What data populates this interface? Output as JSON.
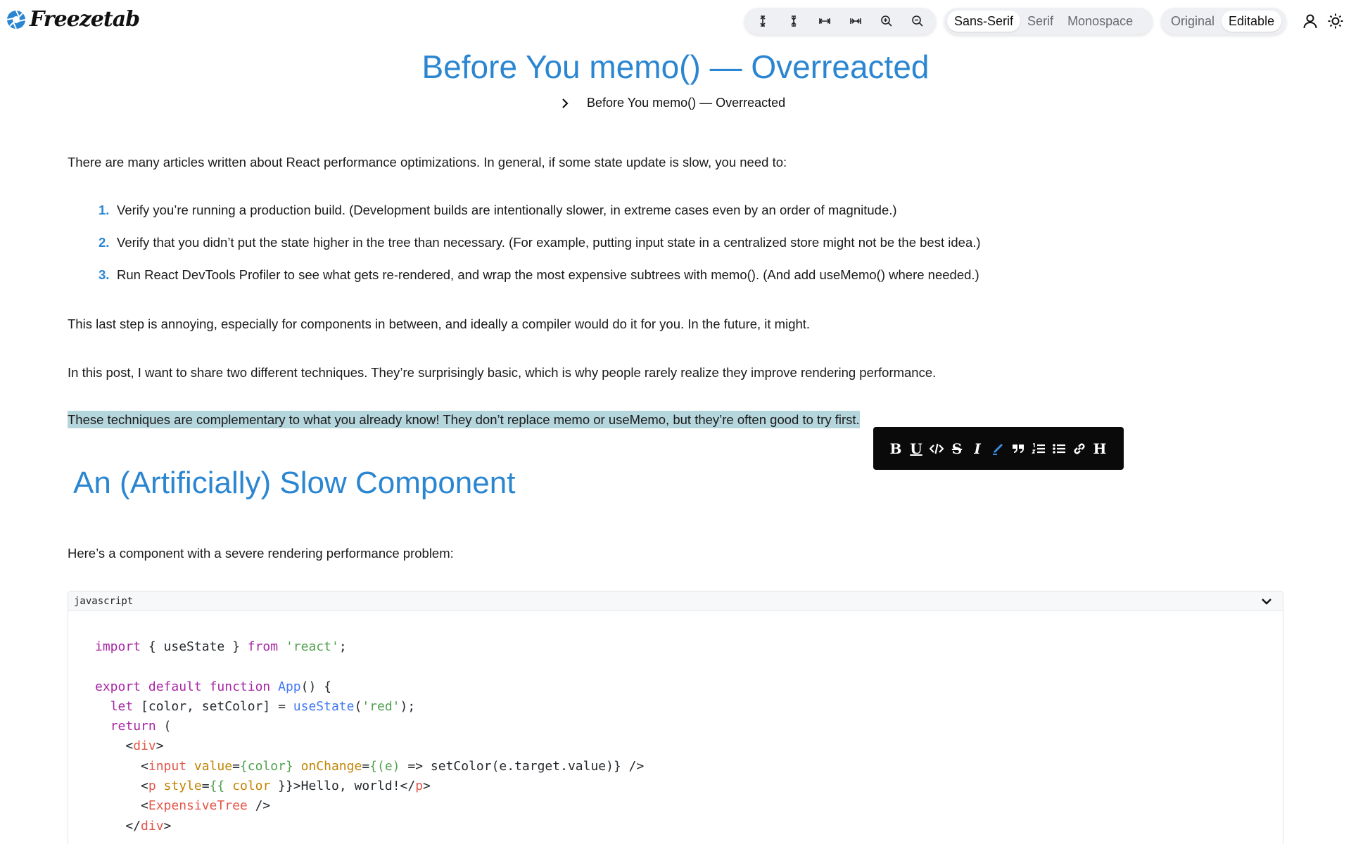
{
  "app": {
    "name": "Freezetab"
  },
  "toolbar": {
    "tools": [
      {
        "name": "increase-line-height-icon"
      },
      {
        "name": "decrease-line-height-icon"
      },
      {
        "name": "increase-width-icon"
      },
      {
        "name": "decrease-width-icon"
      },
      {
        "name": "zoom-in-icon"
      },
      {
        "name": "zoom-out-icon"
      }
    ],
    "fonts": [
      "Sans-Serif",
      "Serif",
      "Monospace"
    ],
    "font_selected": "Sans-Serif",
    "modes": [
      "Original",
      "Editable"
    ],
    "mode_selected": "Editable"
  },
  "article": {
    "title": "Before You memo() — Overreacted",
    "breadcrumb": "Before You memo() — Overreacted",
    "intro": "There are many articles written about React performance optimizations. In general, if some state update is slow, you need to:",
    "steps": [
      {
        "num": "1.",
        "text": "Verify you’re running a production build. (Development builds are intentionally slower, in extreme cases even by an order of magnitude.)"
      },
      {
        "num": "2.",
        "text": "Verify that you didn’t put the state higher in the tree than necessary. (For example, putting input state in a centralized store might not be the best idea.)"
      },
      {
        "num": "3.",
        "text": "Run React DevTools Profiler to see what gets re-rendered, and wrap the most expensive subtrees with memo(). (And add useMemo() where needed.)"
      }
    ],
    "para2": "This last step is annoying, especially for components in between, and ideally a compiler would do it for you. In the future, it might.",
    "para3": "In this post, I want to share two different techniques. They’re surprisingly basic, which is why people rarely realize they improve rendering performance.",
    "para4_highlighted": "These techniques are complementary to what you already know! They don’t replace memo or useMemo, but they’re often good to try first.",
    "section_heading": "An (Artificially) Slow Component",
    "para5": "Here’s a component with a severe rendering performance problem:",
    "code": {
      "language": "javascript",
      "lines": [
        "import { useState } from 'react';",
        "",
        "export default function App() {",
        "  let [color, setColor] = useState('red');",
        "  return (",
        "    <div>",
        "      <input value={color} onChange={(e) => setColor(e.target.value)} />",
        "      <p style={{ color }}>Hello, world!</p>",
        "      <ExpensiveTree />",
        "    </div>"
      ]
    }
  },
  "format_toolbar": {
    "buttons": [
      "bold",
      "underline",
      "code",
      "strikethrough",
      "italic",
      "highlight",
      "quote",
      "ordered-list",
      "bullet-list",
      "link",
      "heading"
    ],
    "highlight_color": "#3b8fe0"
  },
  "colors": {
    "accent": "#2b86d1",
    "highlight_bg": "#b6d6dd"
  }
}
